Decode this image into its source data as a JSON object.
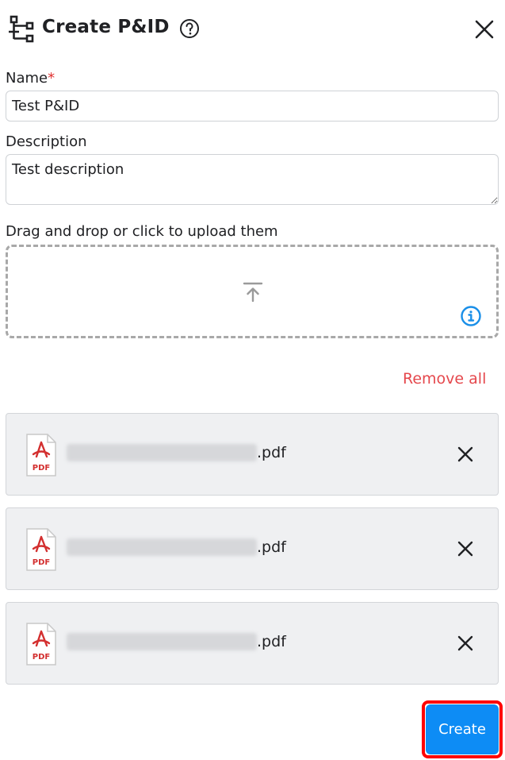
{
  "header": {
    "title": "Create P&ID",
    "icons": {
      "logo": "hierarchy-icon",
      "help": "help-circle-icon",
      "close": "close-icon"
    }
  },
  "form": {
    "name_label": "Name",
    "required_marker": "*",
    "name_value": "Test P&ID",
    "description_label": "Description",
    "description_value": "Test description",
    "upload_label": "Drag and drop or click to upload them",
    "upload_icon": "upload-icon",
    "info_icon": "info-icon"
  },
  "files": {
    "remove_all_label": "Remove all",
    "items": [
      {
        "extension": ".pdf",
        "icon": "pdf-icon"
      },
      {
        "extension": ".pdf",
        "icon": "pdf-icon"
      },
      {
        "extension": ".pdf",
        "icon": "pdf-icon"
      }
    ]
  },
  "actions": {
    "create_label": "Create"
  },
  "colors": {
    "accent": "#0d8cf5",
    "danger": "#e5484d",
    "highlight": "#ff0000",
    "info": "#1a8fe8",
    "pdf_red": "#d32f2f"
  }
}
